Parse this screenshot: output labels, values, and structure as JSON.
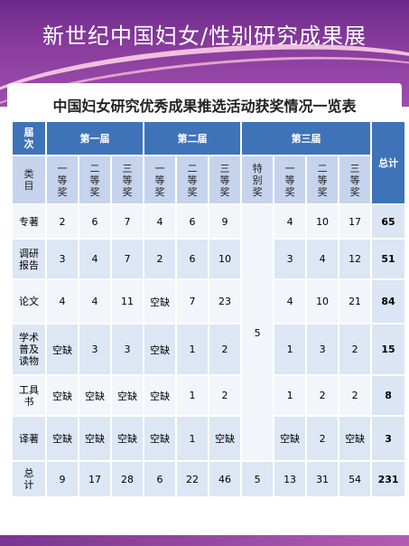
{
  "header": {
    "title": "新世纪中国妇女/性别研究成果展"
  },
  "table_title": "中国妇女研究优秀成果推选活动获奖情况一览表",
  "table": {
    "corner": "届次",
    "corner_bottom": "类目",
    "editions": [
      "第一届",
      "第二届",
      "第三届"
    ],
    "total_header": "总计",
    "subheaders": [
      "一等奖",
      "二等奖",
      "三等奖",
      "一等奖",
      "二等奖",
      "三等奖",
      "特别奖",
      "一等奖",
      "二等奖",
      "三等奖"
    ],
    "rows": [
      {
        "label": "专著",
        "cells": [
          "2",
          "6",
          "7",
          "4",
          "6",
          "9",
          "4",
          "10",
          "17"
        ],
        "total": "65"
      },
      {
        "label": "调研报告",
        "cells": [
          "3",
          "4",
          "7",
          "2",
          "6",
          "10",
          "3",
          "4",
          "12"
        ],
        "total": "51"
      },
      {
        "label": "论文",
        "cells": [
          "4",
          "4",
          "11",
          "空缺",
          "7",
          "23",
          "4",
          "10",
          "21"
        ],
        "total": "84"
      },
      {
        "label": "学术普及读物",
        "cells": [
          "空缺",
          "3",
          "3",
          "空缺",
          "1",
          "2",
          "1",
          "3",
          "2"
        ],
        "total": "15"
      },
      {
        "label": "工具书",
        "cells": [
          "空缺",
          "空缺",
          "空缺",
          "空缺",
          "1",
          "2",
          "1",
          "2",
          "2"
        ],
        "total": "8"
      },
      {
        "label": "译著",
        "cells": [
          "空缺",
          "空缺",
          "空缺",
          "空缺",
          "1",
          "空缺",
          "空缺",
          "2",
          "空缺"
        ],
        "total": "3"
      }
    ],
    "special_merged": "5",
    "totals_row": {
      "label": "总计",
      "cells": [
        "9",
        "17",
        "28",
        "6",
        "22",
        "46",
        "5",
        "13",
        "31",
        "54"
      ],
      "total": "231"
    }
  }
}
